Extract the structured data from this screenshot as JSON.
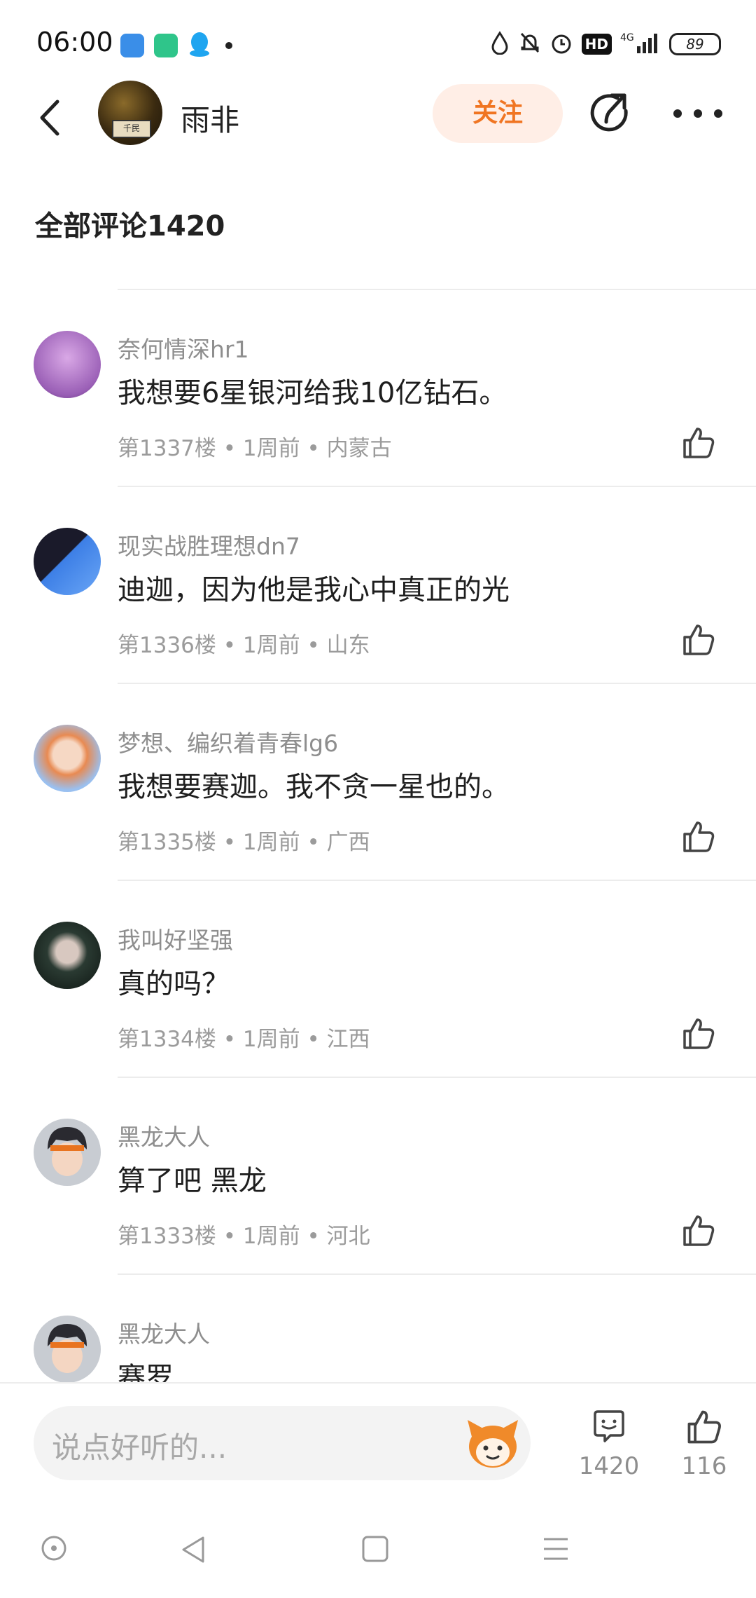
{
  "status_bar": {
    "time": "06:00",
    "app_icons": [
      {
        "name": "feather-app-icon",
        "color": "#3a8ee8"
      },
      {
        "name": "battery-app-icon",
        "color": "#2fc58a"
      },
      {
        "name": "qq-penguin-icon",
        "color": "#1fa5f0"
      }
    ],
    "indicators": [
      "water-drop-icon",
      "bell-muted-icon",
      "alarm-icon"
    ],
    "hd": "HD",
    "network": "4G",
    "battery": "89"
  },
  "header": {
    "author_name": "雨非",
    "follow_label": "关注",
    "avatar_sign": "千民"
  },
  "section": {
    "title": "全部评论1420"
  },
  "comments": [
    {
      "name": "奈何情深hr1",
      "text": "我想要6星银河给我10亿钻石。",
      "meta": "第1337楼 • 1周前 • 内蒙古",
      "avatar_colors": [
        "#d9a8e6",
        "#9a5fb6"
      ]
    },
    {
      "name": "现实战胜理想dn7",
      "text": "迪迦，因为他是我心中真正的光",
      "meta": "第1336楼 • 1周前 • 山东",
      "avatar_colors": [
        "#3d7fe6",
        "#1a1a2a"
      ]
    },
    {
      "name": "梦想、编织着青春lg6",
      "text": "我想要赛迦。我不贪一星也的。",
      "meta": "第1335楼 • 1周前 • 广西",
      "avatar_colors": [
        "#9ac0f0",
        "#e88a52"
      ]
    },
    {
      "name": "我叫好坚强",
      "text": "真的吗？",
      "meta": "第1334楼 • 1周前 • 江西",
      "avatar_colors": [
        "#2a3a32",
        "#0e1612"
      ]
    },
    {
      "name": "黑龙大人",
      "text": "算了吧 黑龙",
      "meta": "第1333楼 • 1周前 • 河北",
      "avatar_colors": [
        "#c8ccd2",
        "#2a2a30"
      ]
    },
    {
      "name": "黑龙大人",
      "text": "赛罗",
      "meta": "",
      "avatar_colors": [
        "#c8ccd2",
        "#2a2a30"
      ]
    }
  ],
  "bottom_bar": {
    "input_placeholder": "说点好听的...",
    "comment_count": "1420",
    "like_count": "116"
  },
  "colors": {
    "accent_orange": "#f07522",
    "follow_bg": "#ffeee6",
    "meta_gray": "#9b9b9b"
  }
}
